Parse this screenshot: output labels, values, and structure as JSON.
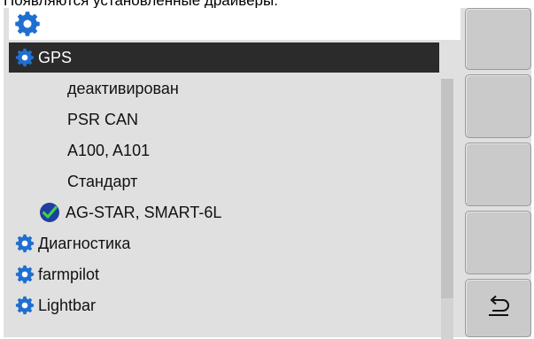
{
  "caption": "Появляются установленные драйверы.",
  "header": {
    "icon": "gear-icon"
  },
  "tree": {
    "items": [
      {
        "label": "GPS",
        "icon": "gear-icon",
        "selected": true
      },
      {
        "label": "деактивирован"
      },
      {
        "label": "PSR CAN"
      },
      {
        "label": "A100, A101"
      },
      {
        "label": "Стандарт"
      },
      {
        "label": "AG-STAR, SMART-6L",
        "icon": "check-icon",
        "status": "active"
      },
      {
        "label": "Диагностика",
        "icon": "gear-icon"
      },
      {
        "label": "farmpilot",
        "icon": "gear-icon"
      },
      {
        "label": "Lightbar",
        "icon": "gear-icon"
      }
    ]
  },
  "softkeys": [
    {
      "name": "softkey-1"
    },
    {
      "name": "softkey-2"
    },
    {
      "name": "softkey-3"
    },
    {
      "name": "softkey-4"
    },
    {
      "name": "softkey-back",
      "icon": "back-arrow-icon"
    }
  ],
  "colors": {
    "gear": "#1f6fd0",
    "selected_bg": "#2b2b2b",
    "panel": "#e0e0e0",
    "check": "#1a9c2a"
  }
}
